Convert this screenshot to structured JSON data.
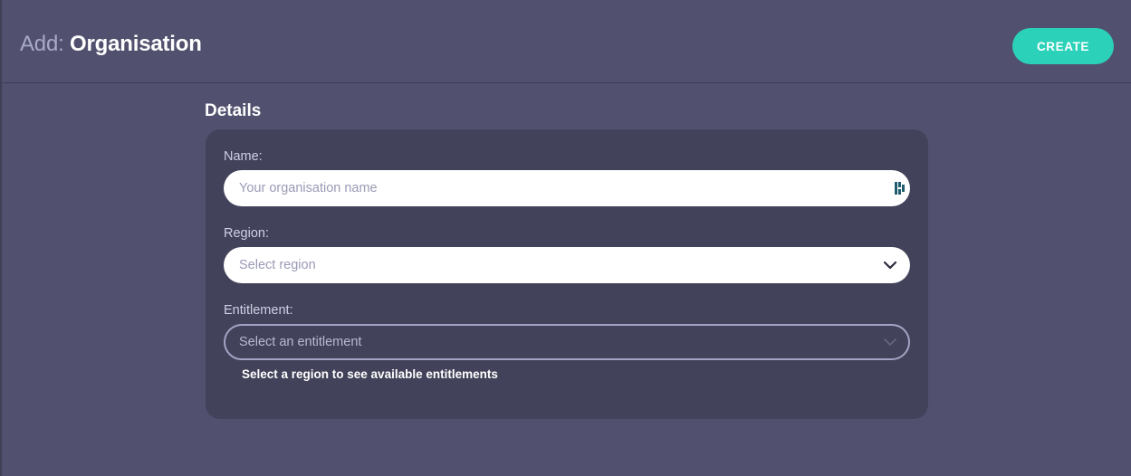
{
  "header": {
    "title_prefix": "Add:",
    "title_main": "Organisation",
    "create_label": "CREATE"
  },
  "details": {
    "section_title": "Details",
    "name": {
      "label": "Name:",
      "placeholder": "Your organisation name"
    },
    "region": {
      "label": "Region:",
      "placeholder": "Select region"
    },
    "entitlement": {
      "label": "Entitlement:",
      "placeholder": "Select an entitlement",
      "helper": "Select a region to see available entitlements"
    }
  },
  "colors": {
    "background": "#51516f",
    "card": "#42425a",
    "accent": "#2bd2b9"
  },
  "icons": {
    "name_field_icon": "password-manager-icon",
    "dropdown_icon": "chevron-down-icon"
  }
}
